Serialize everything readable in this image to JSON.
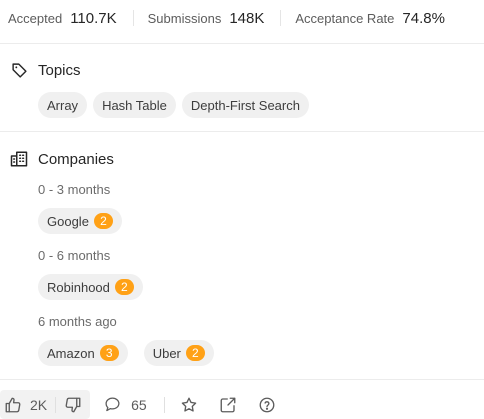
{
  "stats": [
    {
      "label": "Accepted",
      "value": "110.7K"
    },
    {
      "label": "Submissions",
      "value": "148K"
    },
    {
      "label": "Acceptance Rate",
      "value": "74.8%"
    }
  ],
  "topics": {
    "title": "Topics",
    "icon": "tag-icon",
    "tags": [
      "Array",
      "Hash Table",
      "Depth-First Search"
    ]
  },
  "companies": {
    "title": "Companies",
    "icon": "building-icon",
    "groups": [
      {
        "period": "0 - 3 months",
        "items": [
          {
            "name": "Google",
            "count": "2"
          }
        ]
      },
      {
        "period": "0 - 6 months",
        "items": [
          {
            "name": "Robinhood",
            "count": "2"
          }
        ]
      },
      {
        "period": "6 months ago",
        "items": [
          {
            "name": "Amazon",
            "count": "3"
          },
          {
            "name": "Uber",
            "count": "2"
          }
        ]
      }
    ]
  },
  "footer": {
    "likes": "2K",
    "comments": "65",
    "icons": [
      "thumbs-up-icon",
      "thumbs-down-icon",
      "comment-icon",
      "star-icon",
      "share-icon",
      "help-icon"
    ]
  },
  "colors": {
    "badge": "#ffa116",
    "chip": "#f0f0f0",
    "text": "#262626"
  }
}
